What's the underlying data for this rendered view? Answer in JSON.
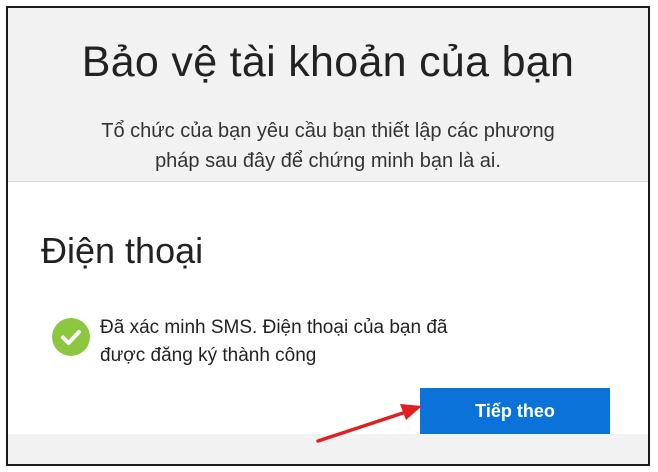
{
  "header": {
    "title": "Bảo vệ tài khoản của bạn",
    "subtitle_line1": "Tổ chức của bạn yêu cầu bạn thiết lập các phương",
    "subtitle_line2": "pháp sau đây để chứng minh bạn là ai."
  },
  "card": {
    "title": "Điện thoại",
    "status_line1": "Đã xác minh SMS. Điện thoại của bạn đã",
    "status_line2": "được đăng ký thành công",
    "status_icon": "checkmark-icon",
    "next_label": "Tiếp theo"
  },
  "annotation": {
    "arrow_icon": "red-arrow-icon",
    "arrow_color": "#e02020"
  },
  "colors": {
    "accent": "#0a72d8",
    "success": "#8dc63f"
  }
}
